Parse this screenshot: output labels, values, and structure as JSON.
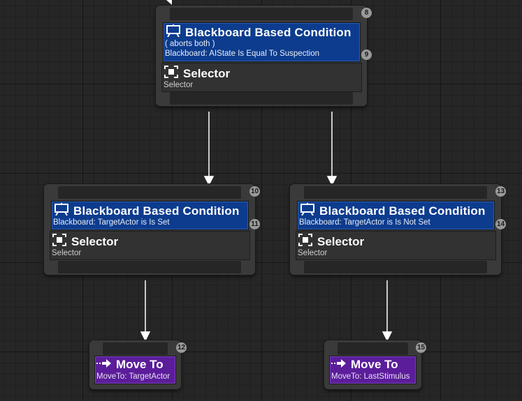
{
  "nodes": {
    "root": {
      "badge_top": "8",
      "badge_dec": "9",
      "decorator": {
        "title": "Blackboard Based Condition",
        "line1": "( aborts both )",
        "line2": "Blackboard: AIState Is Equal To Suspection"
      },
      "composite": {
        "title": "Selector",
        "subtitle": "Selector"
      }
    },
    "left": {
      "badge_top": "10",
      "badge_dec": "11",
      "decorator": {
        "title": "Blackboard Based Condition",
        "line1": "Blackboard: TargetActor is Is Set"
      },
      "composite": {
        "title": "Selector",
        "subtitle": "Selector"
      }
    },
    "right": {
      "badge_top": "13",
      "badge_dec": "14",
      "decorator": {
        "title": "Blackboard Based Condition",
        "line1": "Blackboard: TargetActor is Is Not Set"
      },
      "composite": {
        "title": "Selector",
        "subtitle": "Selector"
      }
    },
    "task_left": {
      "badge": "12",
      "title": "Move To",
      "subtitle": "MoveTo: TargetActor"
    },
    "task_right": {
      "badge": "15",
      "title": "Move To",
      "subtitle": "MoveTo: LastStimulus"
    }
  },
  "icons": {
    "decorator": "blackboard-icon",
    "composite": "selector-icon",
    "task": "move-to-icon"
  },
  "colors": {
    "decorator": "#0d3c8e",
    "task": "#5b1d9a",
    "node": "#3a3a3a",
    "badge": "#9a9a9a"
  }
}
